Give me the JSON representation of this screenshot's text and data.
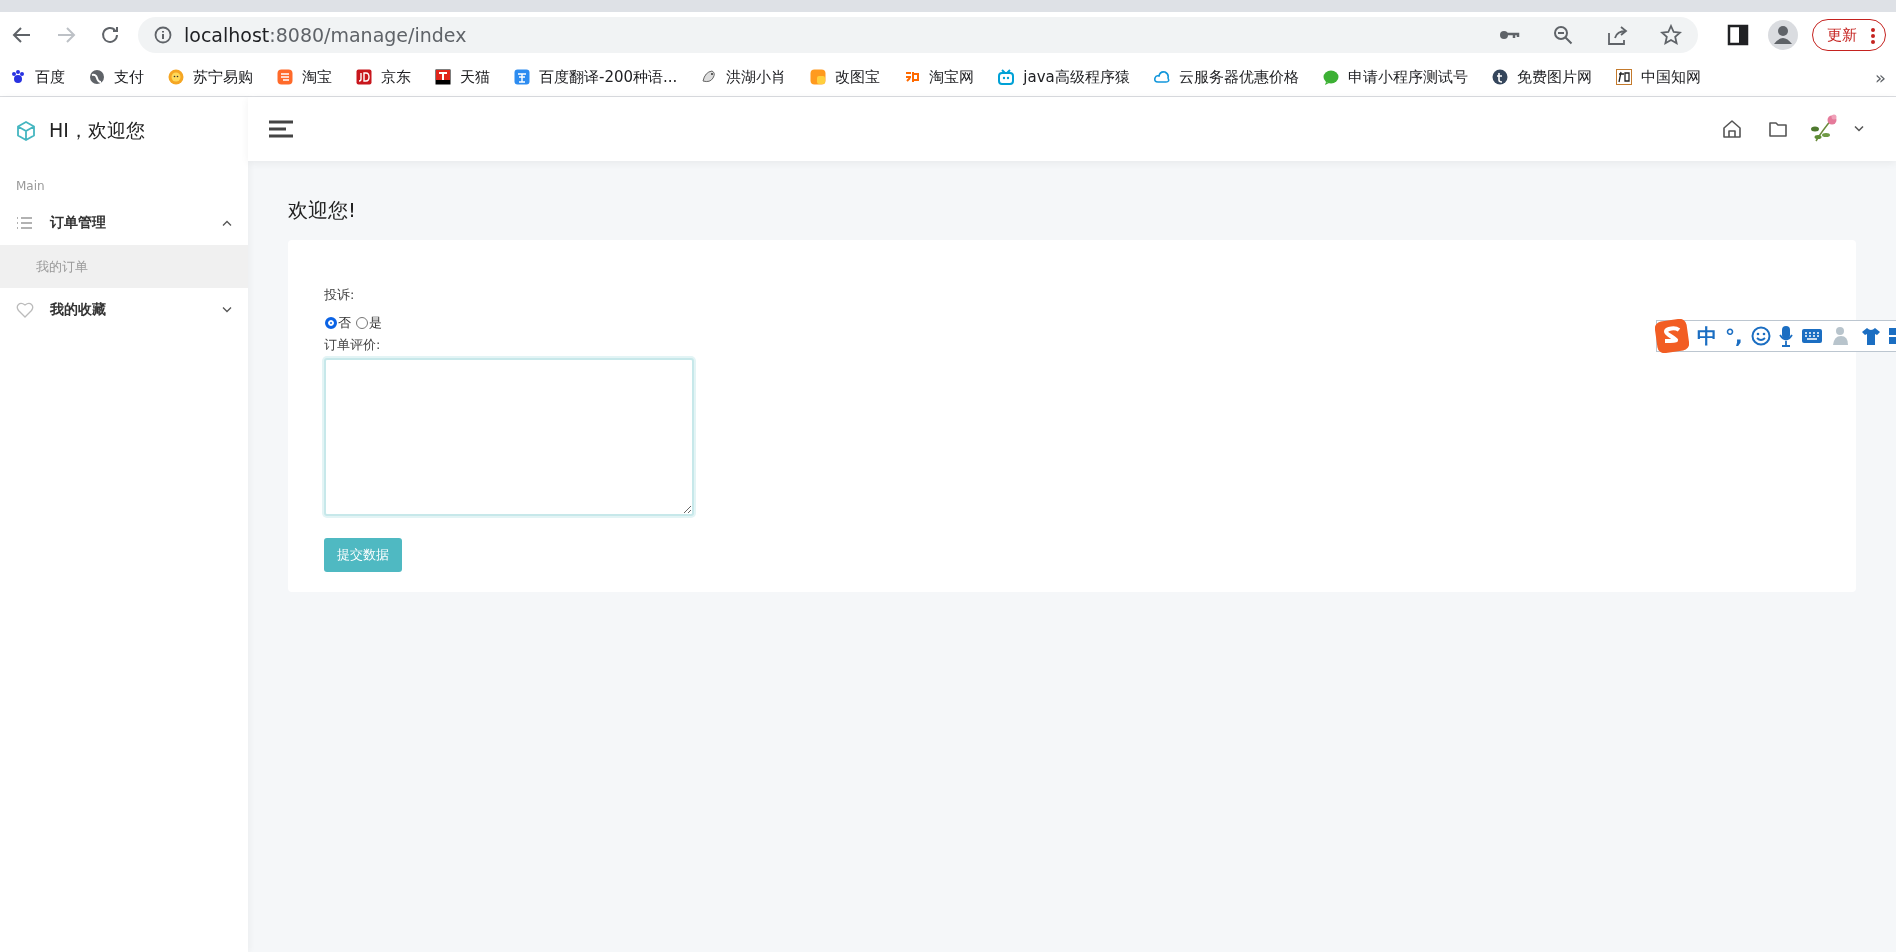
{
  "browser": {
    "url_host": "localhost",
    "url_rest": ":8080/manage/index",
    "update_button": "更新",
    "bookmarks": [
      {
        "label": "百度"
      },
      {
        "label": "支付"
      },
      {
        "label": "苏宁易购"
      },
      {
        "label": "淘宝"
      },
      {
        "label": "京东"
      },
      {
        "label": "天猫"
      },
      {
        "label": "百度翻译-200种语..."
      },
      {
        "label": "洪湖小肖"
      },
      {
        "label": "改图宝"
      },
      {
        "label": "淘宝网"
      },
      {
        "label": "java高级程序猿"
      },
      {
        "label": "云服务器优惠价格"
      },
      {
        "label": "申请小程序测试号"
      },
      {
        "label": "免费图片网"
      },
      {
        "label": "中国知网"
      }
    ],
    "more": "»"
  },
  "sidebar": {
    "title": "HI，欢迎您",
    "section": "Main",
    "menu": [
      {
        "label": "订单管理",
        "expanded": true,
        "children": [
          {
            "label": "我的订单",
            "selected": true
          }
        ]
      },
      {
        "label": "我的收藏",
        "expanded": false
      }
    ]
  },
  "page": {
    "heading": "欢迎您!",
    "complaint_label": "投诉:",
    "options": [
      {
        "label": "否",
        "selected": true
      },
      {
        "label": "是",
        "selected": false
      }
    ],
    "review_label": "订单评价:",
    "submit": "提交数据"
  },
  "ime": {
    "labels": [
      "中",
      "°,"
    ]
  }
}
